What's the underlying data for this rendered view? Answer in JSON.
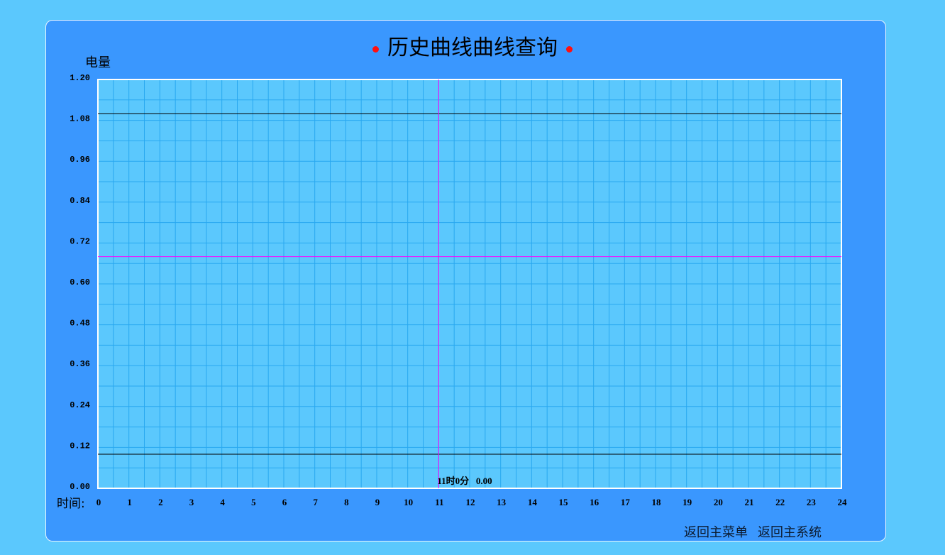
{
  "title": "历史曲线曲线查询",
  "colors": {
    "background": "#5bc8fd",
    "panel": "#3a97fe",
    "plot_bg": "#5bc8fd",
    "grid": "#29a8f0",
    "limit_lines": "#000000",
    "crosshair": "#ff00ff",
    "title_dots": "#ff1010"
  },
  "chart_data": {
    "type": "line",
    "ylabel": "电量",
    "xlabel": "时间:",
    "xlim": [
      0,
      24
    ],
    "ylim": [
      0,
      1.2
    ],
    "x_ticks": [
      "0",
      "1",
      "2",
      "3",
      "4",
      "5",
      "6",
      "7",
      "8",
      "9",
      "10",
      "11",
      "12",
      "13",
      "14",
      "15",
      "16",
      "17",
      "18",
      "19",
      "20",
      "21",
      "22",
      "23",
      "24"
    ],
    "y_ticks": [
      "0.00",
      "0.12",
      "0.24",
      "0.36",
      "0.48",
      "0.60",
      "0.72",
      "0.84",
      "0.96",
      "1.08",
      "1.20"
    ],
    "grid": true,
    "series": [
      {
        "x": [],
        "y": []
      }
    ],
    "upper_limit": 1.1,
    "lower_limit": 0.1,
    "cursor": {
      "x": 11,
      "y": 0.68
    },
    "cursor_readout": "11时0分   0.00"
  },
  "buttons": {
    "back_menu": "返回主菜单",
    "back_system": "返回主系统"
  }
}
